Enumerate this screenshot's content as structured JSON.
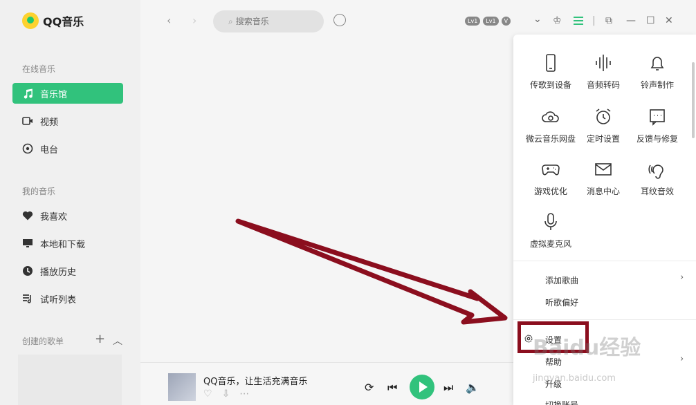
{
  "app": {
    "logo_text": "QQ音乐"
  },
  "sidebar": {
    "section_online": "在线音乐",
    "online_items": [
      {
        "label": "音乐馆",
        "icon": "music-note-icon",
        "active": true
      },
      {
        "label": "视频",
        "icon": "video-icon"
      },
      {
        "label": "电台",
        "icon": "radio-icon"
      }
    ],
    "section_mine": "我的音乐",
    "mine_items": [
      {
        "label": "我喜欢",
        "icon": "heart-icon"
      },
      {
        "label": "本地和下载",
        "icon": "monitor-icon"
      },
      {
        "label": "播放历史",
        "icon": "history-icon"
      },
      {
        "label": "试听列表",
        "icon": "playlist-icon"
      }
    ],
    "section_created": "创建的歌单"
  },
  "topbar": {
    "search_placeholder": "搜索音乐",
    "badges": [
      "Lv1",
      "Lv1",
      "V"
    ]
  },
  "popup": {
    "grid": [
      {
        "label": "传歌到设备",
        "icon": "phone-icon"
      },
      {
        "label": "音频转码",
        "icon": "waveform-icon"
      },
      {
        "label": "铃声制作",
        "icon": "bell-icon"
      },
      {
        "label": "微云音乐网盘",
        "icon": "cloud-icon"
      },
      {
        "label": "定时设置",
        "icon": "alarm-clock-icon"
      },
      {
        "label": "反馈与修复",
        "icon": "feedback-icon"
      },
      {
        "label": "游戏优化",
        "icon": "gamepad-icon"
      },
      {
        "label": "消息中心",
        "icon": "mail-icon"
      },
      {
        "label": "耳纹音效",
        "icon": "ear-icon"
      },
      {
        "label": "虚拟麦克风",
        "icon": "microphone-icon"
      }
    ],
    "add_song": "添加歌曲",
    "listen_pref": "听歌偏好",
    "settings": "设置",
    "help": "帮助",
    "upgrade": "升级",
    "switch_account": "切换账号"
  },
  "player": {
    "song_title": "QQ音乐，让生活充满音乐"
  },
  "watermark": {
    "text": "Baidu经验",
    "sub": "jingyan.baidu.com"
  },
  "colors": {
    "accent": "#31c27c",
    "annotation": "#8b0e1e"
  }
}
